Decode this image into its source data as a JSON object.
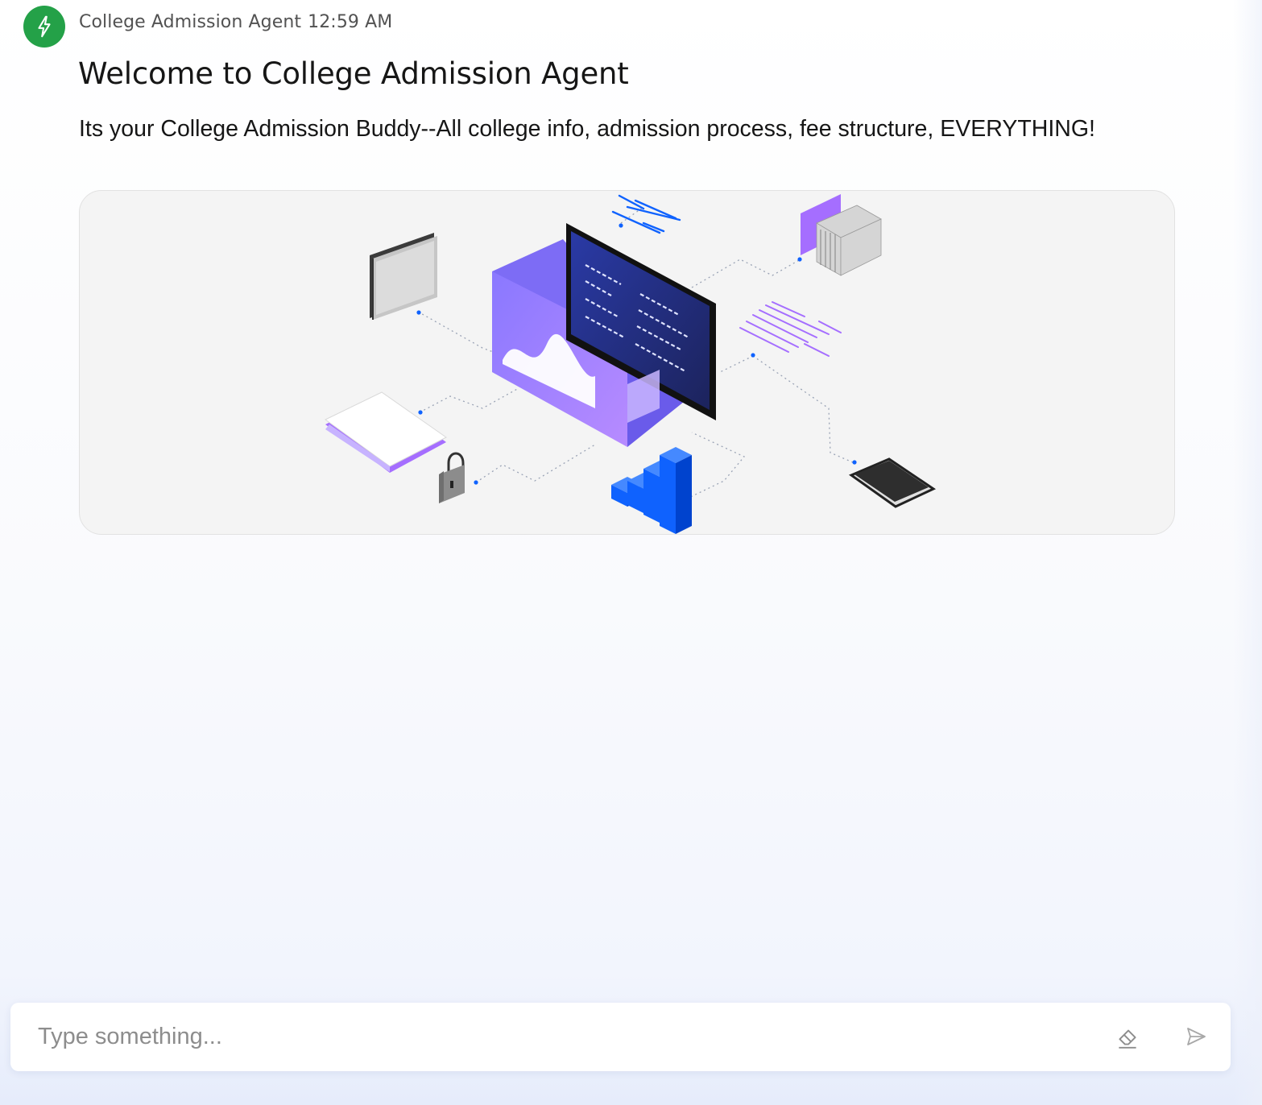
{
  "message": {
    "author": "College Admission Agent",
    "time": "12:59 AM",
    "title": "Welcome to College Admission Agent",
    "subtitle": "Its your College Admission Buddy--All college info, admission process, fee structure, EVERYTHING!",
    "illustration_icons": [
      "folder-icon",
      "code-monitor-icon",
      "server-stack-icon",
      "text-lines-icon",
      "book-icon",
      "padlock-icon",
      "bar-chart-icon",
      "tablet-icon"
    ]
  },
  "composer": {
    "placeholder": "Type something...",
    "value": "",
    "clear_icon": "eraser-icon",
    "send_icon": "send-icon"
  },
  "colors": {
    "avatar": "#24a148",
    "text_primary": "#161616",
    "text_secondary": "#525252",
    "card_bg": "#f4f4f4",
    "accent_blue": "#0f62fe",
    "accent_purple": "#a56eff"
  }
}
